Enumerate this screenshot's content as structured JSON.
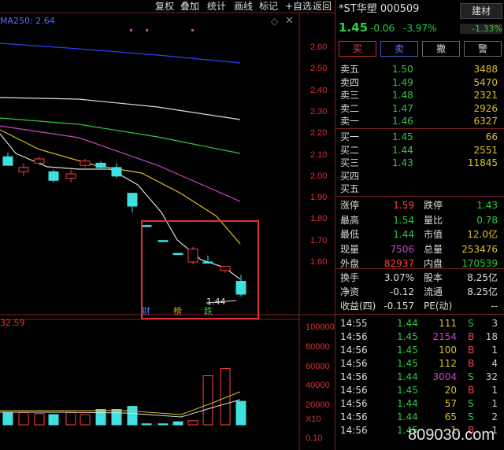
{
  "toolbar": [
    "复权",
    "叠加",
    "统计",
    "画线",
    "标记",
    "+自选",
    "返回"
  ],
  "ma_label": "MA250: 2.64",
  "vol_label": "32.59",
  "price_axis": [
    "2.60",
    "2.50",
    "2.40",
    "2.30",
    "2.20",
    "2.10",
    "2.00",
    "1.90",
    "1.80",
    "1.70",
    "1.60"
  ],
  "vol_axis": [
    "100000",
    "80000",
    "60000",
    "40000",
    "20000",
    "X10",
    "0.10"
  ],
  "markers": {
    "cai": "财",
    "bang": "榜",
    "die": "跌",
    "low_label": "1.44"
  },
  "header": {
    "name": "*ST华塑 000509",
    "sector": "建材",
    "price": "1.45",
    "change": "-0.06",
    "pct": "-3.97%",
    "sector_pct": "-1.33%"
  },
  "buttons": [
    "买",
    "卖",
    "撤",
    "警"
  ],
  "sell": [
    {
      "l": "卖五",
      "p": "1.50",
      "v": "3488"
    },
    {
      "l": "卖四",
      "p": "1.49",
      "v": "5470"
    },
    {
      "l": "卖三",
      "p": "1.48",
      "v": "2321"
    },
    {
      "l": "卖二",
      "p": "1.47",
      "v": "2926"
    },
    {
      "l": "卖一",
      "p": "1.46",
      "v": "6327"
    }
  ],
  "buy": [
    {
      "l": "买一",
      "p": "1.45",
      "v": "66"
    },
    {
      "l": "买二",
      "p": "1.44",
      "v": "2551"
    },
    {
      "l": "买三",
      "p": "1.43",
      "v": "11845"
    },
    {
      "l": "买四",
      "p": "",
      "v": ""
    },
    {
      "l": "买五",
      "p": "",
      "v": ""
    }
  ],
  "stats": [
    {
      "a": "涨停",
      "av": "1.59",
      "b": "跌停",
      "bv": "1.43"
    },
    {
      "a": "最高",
      "av": "1.54",
      "b": "量比",
      "bv": "0.78"
    },
    {
      "a": "最低",
      "av": "1.44",
      "b": "市值",
      "bv": "12.0亿"
    },
    {
      "a": "现量",
      "av": "7506",
      "b": "总量",
      "bv": "253476"
    },
    {
      "a": "外盘",
      "av": "82937",
      "b": "内盘",
      "bv": "170539"
    }
  ],
  "stats2": [
    {
      "a": "换手",
      "av": "3.07%",
      "b": "股本",
      "bv": "8.25亿"
    },
    {
      "a": "净资",
      "av": "-0.12",
      "b": "流通",
      "bv": "8.25亿"
    },
    {
      "a": "收益(四)",
      "av": "-0.157",
      "b": "PE(动)",
      "bv": "--"
    }
  ],
  "ticks": [
    {
      "t": "14:55",
      "p": "1.44",
      "v": "111",
      "s": "S",
      "n": "3"
    },
    {
      "t": "14:56",
      "p": "1.45",
      "v": "2154",
      "s": "B",
      "n": "18"
    },
    {
      "t": "14:56",
      "p": "1.45",
      "v": "100",
      "s": "B",
      "n": "1"
    },
    {
      "t": "14:56",
      "p": "1.45",
      "v": "112",
      "s": "B",
      "n": "4"
    },
    {
      "t": "14:56",
      "p": "1.44",
      "v": "3004",
      "s": "S",
      "n": "32"
    },
    {
      "t": "14:56",
      "p": "1.45",
      "v": "20",
      "s": "B",
      "n": "1"
    },
    {
      "t": "14:56",
      "p": "1.44",
      "v": "57",
      "s": "S",
      "n": "1"
    },
    {
      "t": "14:56",
      "p": "1.44",
      "v": "65",
      "s": "S",
      "n": "2"
    },
    {
      "t": "14:56",
      "p": "1.45",
      "v": "1",
      "s": "B",
      "n": "1"
    }
  ],
  "watermark": "809030.com",
  "chart_data": {
    "type": "candlestick",
    "candles": [
      {
        "o": 2.05,
        "c": 2.09,
        "h": 2.11,
        "l": 2.05,
        "up": false
      },
      {
        "o": 2.04,
        "c": 2.02,
        "h": 2.06,
        "l": 2.0,
        "up": true
      },
      {
        "o": 2.06,
        "c": 2.08,
        "h": 2.09,
        "l": 2.05,
        "up": true
      },
      {
        "o": 2.02,
        "c": 1.98,
        "h": 2.03,
        "l": 1.97,
        "up": false
      },
      {
        "o": 1.99,
        "c": 2.01,
        "h": 2.03,
        "l": 1.97,
        "up": true
      },
      {
        "o": 2.05,
        "c": 2.07,
        "h": 2.08,
        "l": 2.04,
        "up": true
      },
      {
        "o": 2.06,
        "c": 2.04,
        "h": 2.07,
        "l": 2.03,
        "up": false
      },
      {
        "o": 2.04,
        "c": 2.0,
        "h": 2.06,
        "l": 1.99,
        "up": false
      },
      {
        "o": 1.92,
        "c": 1.86,
        "h": 1.92,
        "l": 1.83,
        "up": false
      },
      {
        "o": 1.77,
        "c": 1.77,
        "h": 1.77,
        "l": 1.77,
        "up": false
      },
      {
        "o": 1.7,
        "c": 1.7,
        "h": 1.7,
        "l": 1.7,
        "up": false
      },
      {
        "o": 1.64,
        "c": 1.64,
        "h": 1.64,
        "l": 1.64,
        "up": false
      },
      {
        "o": 1.6,
        "c": 1.66,
        "h": 1.67,
        "l": 1.59,
        "up": true
      },
      {
        "o": 1.6,
        "c": 1.6,
        "h": 1.63,
        "l": 1.6,
        "up": false
      },
      {
        "o": 1.56,
        "c": 1.58,
        "h": 1.58,
        "l": 1.55,
        "up": true
      },
      {
        "o": 1.51,
        "c": 1.45,
        "h": 1.54,
        "l": 1.44,
        "up": false
      }
    ],
    "volume": [
      12000,
      12000,
      11000,
      10000,
      12000,
      10000,
      15000,
      15000,
      18000,
      1000,
      1000,
      3000,
      4000,
      48000,
      55000,
      23000,
      25000
    ]
  }
}
